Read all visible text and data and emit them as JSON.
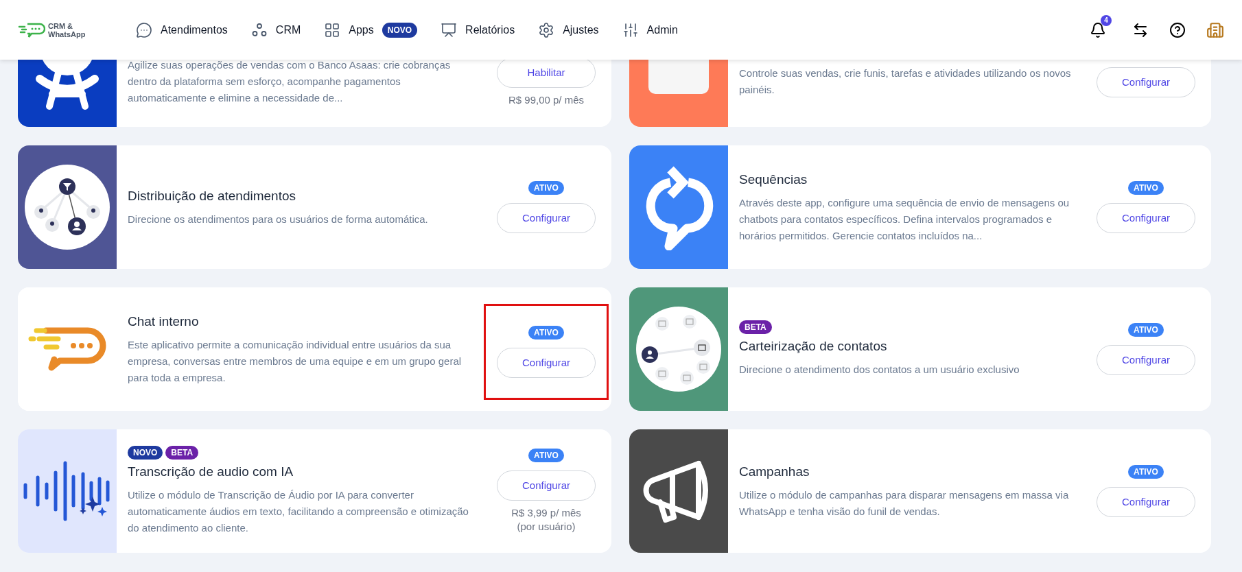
{
  "header": {
    "logo_lines": [
      "CRM &",
      "WhatsApp"
    ],
    "nav": [
      {
        "label": "Atendimentos"
      },
      {
        "label": "CRM"
      },
      {
        "label": "Apps",
        "badge": "NOVO"
      },
      {
        "label": "Relatórios"
      },
      {
        "label": "Ajustes"
      },
      {
        "label": "Admin"
      }
    ],
    "notification_count": "4"
  },
  "apps": [
    {
      "description": "Agilize suas operações de vendas com o Banco Asaas: crie cobranças dentro da plataforma sem esforço, acompanhe pagamentos automaticamente e elimine a necessidade de...",
      "button": "Habilitar",
      "price": [
        "R$ 99,00 p/ mês"
      ],
      "highlighted": false
    },
    {
      "description": "Controle suas vendas, crie funis, tarefas e atividades utilizando os novos painéis.",
      "button": "Configurar",
      "highlighted": false
    },
    {
      "title": "Distribuição de atendimentos",
      "description": "Direcione os atendimentos para os usuários de forma automática.",
      "status": "ATIVO",
      "button": "Configurar",
      "highlighted": false
    },
    {
      "title": "Sequências",
      "description": "Através deste app, configure uma sequência de envio de mensagens ou chatbots para contatos específicos. Defina intervalos programados e horários permitidos. Gerencie contatos incluídos na...",
      "status": "ATIVO",
      "button": "Configurar",
      "highlighted": false
    },
    {
      "title": "Chat interno",
      "description": "Este aplicativo permite a comunicação individual entre usuários da sua empresa, conversas entre membros de uma equipe e em um grupo geral para toda a empresa.",
      "status": "ATIVO",
      "button": "Configurar",
      "highlighted": true
    },
    {
      "tags": [
        {
          "label": "BETA",
          "kind": "beta"
        }
      ],
      "title": "Carteirização de contatos",
      "description": "Direcione o atendimento dos contatos a um usuário exclusivo",
      "status": "ATIVO",
      "button": "Configurar",
      "highlighted": false
    },
    {
      "tags": [
        {
          "label": "NOVO",
          "kind": "novo"
        },
        {
          "label": "BETA",
          "kind": "beta"
        }
      ],
      "title": "Transcrição de audio com IA",
      "description": "Utilize o módulo de Transcrição de Áudio por IA para converter automaticamente áudios em texto, facilitando a compreensão e otimização do atendimento ao cliente.",
      "status": "ATIVO",
      "button": "Configurar",
      "price": [
        "R$ 3,99 p/ mês",
        "(por usuário)"
      ],
      "highlighted": false
    },
    {
      "title": "Campanhas",
      "description": "Utilize o módulo de campanhas para disparar mensagens em massa via WhatsApp e tenha visão do funil de vendas.",
      "status": "ATIVO",
      "button": "Configurar",
      "highlighted": false
    }
  ]
}
